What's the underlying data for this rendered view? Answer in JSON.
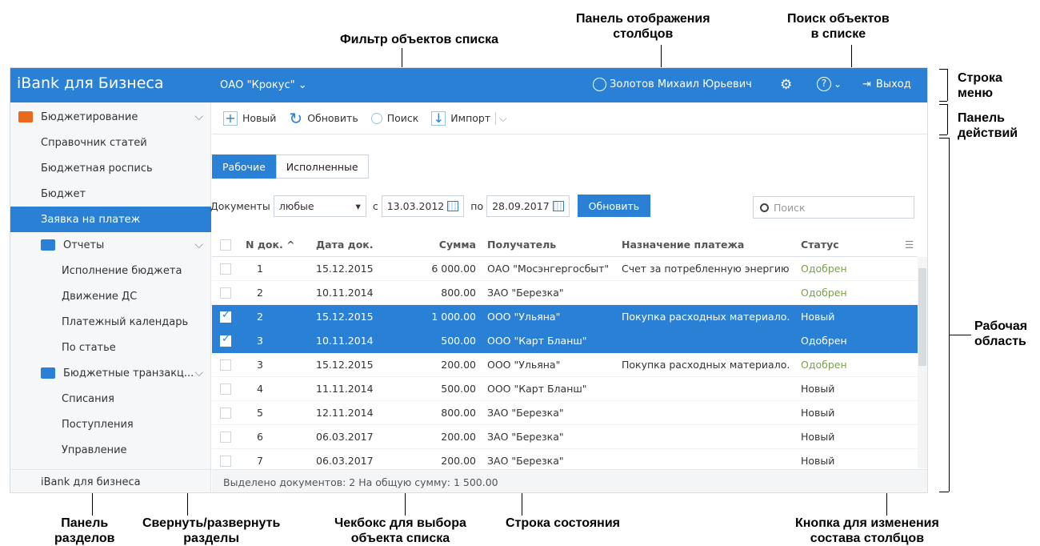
{
  "annotations": {
    "filter": "Фильтр объектов списка",
    "columns_panel_1": "Панель отображения",
    "columns_panel_2": "столбцов",
    "search_1": "Поиск объектов",
    "search_2": "в списке",
    "menubar_1": "Строка",
    "menubar_2": "меню",
    "actions_1": "Панель",
    "actions_2": "действий",
    "work_1": "Рабочая",
    "work_2": "область",
    "sections_1": "Панель",
    "sections_2": "разделов",
    "collapse_1": "Свернуть/развернуть",
    "collapse_2": "разделы",
    "checkbox_1": "Чекбокс для выбора",
    "checkbox_2": "объекта списка",
    "statusbar": "Строка состояния",
    "colbtn_1": "Кнопка для изменения",
    "colbtn_2": "состава столбцов"
  },
  "menubar": {
    "brand": "iBank для Бизнеса",
    "org": "ОАО \"Крокус\"",
    "user": "Золотов Михаил Юрьевич",
    "logout": "Выход"
  },
  "sidebar": {
    "items": [
      {
        "label": "Бюджетирование"
      },
      {
        "label": "Справочник статей"
      },
      {
        "label": "Бюджетная роспись"
      },
      {
        "label": "Бюджет"
      },
      {
        "label": "Заявка на платеж"
      },
      {
        "label": "Отчеты"
      },
      {
        "label": "Исполнение бюджета"
      },
      {
        "label": "Движение ДС"
      },
      {
        "label": "Платежный календарь"
      },
      {
        "label": "По статье"
      },
      {
        "label": "Бюджетные транзакц..."
      },
      {
        "label": "Списания"
      },
      {
        "label": "Поступления"
      },
      {
        "label": "Управление"
      }
    ],
    "footer": "iBank для бизнеса"
  },
  "toolbar": {
    "new": "Новый",
    "refresh": "Обновить",
    "search": "Поиск",
    "import": "Импорт"
  },
  "tabs": [
    "Рабочие",
    "Исполненные"
  ],
  "filter": {
    "docs_label": "Документы",
    "docs_value": "любые",
    "from_label": "с",
    "from_date": "13.03.2012",
    "to_label": "по",
    "to_date": "28.09.2017",
    "button": "Обновить"
  },
  "search": {
    "placeholder": "Поиск"
  },
  "table": {
    "headers": [
      "N док. ^",
      "Дата док.",
      "Сумма",
      "Получатель",
      "Назначение платежа",
      "Статус"
    ],
    "rows": [
      {
        "n": "1",
        "date": "15.12.2015",
        "sum": "6 000.00",
        "payee": "ОАО \"Мосэнгергосбыт\"",
        "purpose": "Счет за потребленную энергию",
        "status": "Одобрен",
        "checked": false,
        "selected": false
      },
      {
        "n": "2",
        "date": "10.11.2014",
        "sum": "800.00",
        "payee": "ЗАО \"Березка\"",
        "purpose": "",
        "status": "Одобрен",
        "checked": false,
        "selected": false
      },
      {
        "n": "2",
        "date": "15.12.2015",
        "sum": "1 000.00",
        "payee": "ООО \"Ульяна\"",
        "purpose": "Покупка расходных материало...",
        "status": "Новый",
        "checked": true,
        "selected": true
      },
      {
        "n": "3",
        "date": "10.11.2014",
        "sum": "500.00",
        "payee": "ООО \"Карт Бланш\"",
        "purpose": "",
        "status": "Одобрен",
        "checked": true,
        "selected": true
      },
      {
        "n": "3",
        "date": "15.12.2015",
        "sum": "200.00",
        "payee": "ООО \"Ульяна\"",
        "purpose": "Покупка расходных материало...",
        "status": "Одобрен",
        "checked": false,
        "selected": false
      },
      {
        "n": "4",
        "date": "11.11.2014",
        "sum": "500.00",
        "payee": "ООО \"Карт Бланш\"",
        "purpose": "",
        "status": "Новый",
        "checked": false,
        "selected": false
      },
      {
        "n": "5",
        "date": "12.11.2014",
        "sum": "800.00",
        "payee": "ЗАО \"Березка\"",
        "purpose": "",
        "status": "Новый",
        "checked": false,
        "selected": false
      },
      {
        "n": "6",
        "date": "06.03.2017",
        "sum": "200.00",
        "payee": "ЗАО \"Березка\"",
        "purpose": "",
        "status": "Новый",
        "checked": false,
        "selected": false
      },
      {
        "n": "7",
        "date": "06.03.2017",
        "sum": "200.00",
        "payee": "ЗАО \"Березка\"",
        "purpose": "",
        "status": "Новый",
        "checked": false,
        "selected": false
      }
    ]
  },
  "status": "Выделено документов: 2 На общую сумму: 1 500.00",
  "colors": {
    "accent": "#2a80d5",
    "approved": "#7aa244"
  }
}
